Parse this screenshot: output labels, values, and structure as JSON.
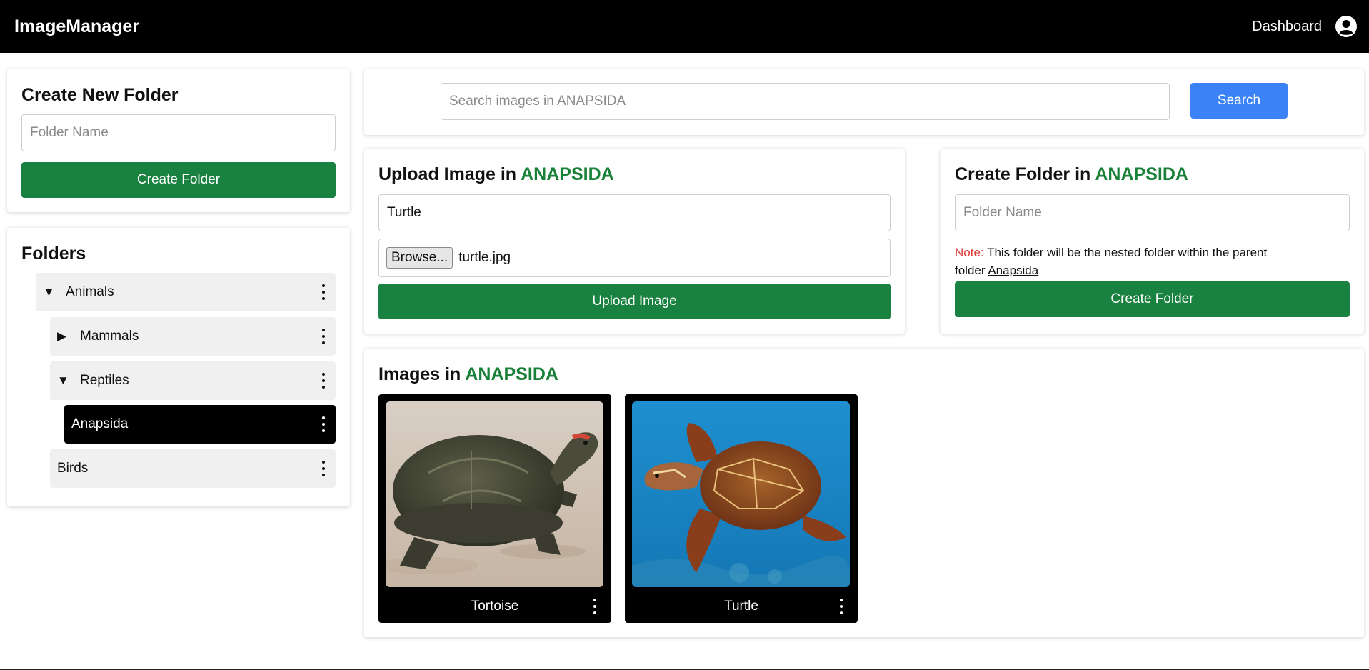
{
  "header": {
    "brand": "ImageManager",
    "dashboard_label": "Dashboard",
    "user_icon": "user-circle-icon"
  },
  "create_new_folder": {
    "title": "Create New Folder",
    "name_placeholder": "Folder Name",
    "button_label": "Create Folder"
  },
  "folders": {
    "title": "Folders",
    "items": [
      {
        "label": "Animals",
        "expander": "▼",
        "state": "expanded",
        "active": false
      },
      {
        "label": "Mammals",
        "expander": "▶",
        "state": "collapsed",
        "active": false
      },
      {
        "label": "Reptiles",
        "expander": "▼",
        "state": "expanded",
        "active": false
      },
      {
        "label": "Anapsida",
        "expander": "",
        "state": "leaf",
        "active": true
      },
      {
        "label": "Birds",
        "expander": "",
        "state": "leaf",
        "active": false
      }
    ]
  },
  "search": {
    "placeholder": "Search images in ANAPSIDA",
    "button_label": "Search"
  },
  "upload": {
    "title_prefix": "Upload Image in",
    "folder_name": "ANAPSIDA",
    "name_value": "Turtle",
    "browse_label": "Browse...",
    "file_name": "turtle.jpg",
    "button_label": "Upload Image"
  },
  "create_nested_folder": {
    "title_prefix": "Create Folder in",
    "folder_name": "ANAPSIDA",
    "name_placeholder": "Folder Name",
    "note_label": "Note:",
    "note_text": "This folder will be the nested folder within the parent folder",
    "parent_link": "Anapsida",
    "button_label": "Create Folder"
  },
  "images": {
    "title_prefix": "Images in",
    "folder_name": "ANAPSIDA",
    "items": [
      {
        "caption": "Tortoise"
      },
      {
        "caption": "Turtle"
      }
    ]
  },
  "colors": {
    "accent_green": "#198038",
    "button_green": "#1a8240",
    "button_blue": "#3b82f6",
    "note_red": "#e03a3a",
    "header_bg": "#000000"
  }
}
